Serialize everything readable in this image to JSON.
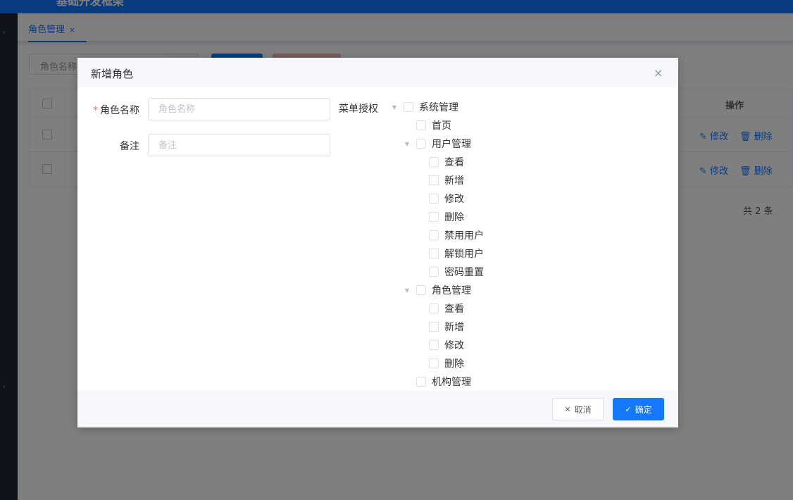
{
  "app": {
    "title": "基础开发框架"
  },
  "tabs": [
    {
      "label": "角色管理",
      "close": "×"
    }
  ],
  "toolbar": {
    "search_placeholder": "角色名称"
  },
  "table": {
    "header_op": "操作",
    "rows": [
      {
        "edit": "修改",
        "delete": "删除"
      },
      {
        "edit": "修改",
        "delete": "删除"
      }
    ],
    "total": "共 2 条"
  },
  "modal": {
    "title": "新增角色",
    "close": "×",
    "fields": {
      "role_name": {
        "label": "角色名称",
        "placeholder": "角色名称",
        "required_mark": "*"
      },
      "remark": {
        "label": "备注",
        "placeholder": "备注"
      }
    },
    "menu_label": "菜单授权",
    "tree": [
      {
        "label": "系统管理",
        "level": 0,
        "expanded": true
      },
      {
        "label": "首页",
        "level": 1,
        "expanded": null
      },
      {
        "label": "用户管理",
        "level": 1,
        "expanded": true
      },
      {
        "label": "查看",
        "level": 2,
        "expanded": null
      },
      {
        "label": "新增",
        "level": 2,
        "expanded": null
      },
      {
        "label": "修改",
        "level": 2,
        "expanded": null
      },
      {
        "label": "删除",
        "level": 2,
        "expanded": null
      },
      {
        "label": "禁用用户",
        "level": 2,
        "expanded": null
      },
      {
        "label": "解锁用户",
        "level": 2,
        "expanded": null
      },
      {
        "label": "密码重置",
        "level": 2,
        "expanded": null
      },
      {
        "label": "角色管理",
        "level": 1,
        "expanded": true
      },
      {
        "label": "查看",
        "level": 2,
        "expanded": null
      },
      {
        "label": "新增",
        "level": 2,
        "expanded": null
      },
      {
        "label": "修改",
        "level": 2,
        "expanded": null
      },
      {
        "label": "删除",
        "level": 2,
        "expanded": null
      },
      {
        "label": "机构管理",
        "level": 1,
        "expanded": null
      }
    ],
    "buttons": {
      "cancel": "取消",
      "confirm": "确定"
    }
  },
  "icons": {
    "close": "close-icon",
    "check": "check-icon",
    "edit": "edit-icon",
    "trash": "trash-icon",
    "caret": "caret-down-icon"
  },
  "colors": {
    "primary": "#1677ff",
    "danger_light": "#fab6b6",
    "required": "#f56c6c"
  }
}
